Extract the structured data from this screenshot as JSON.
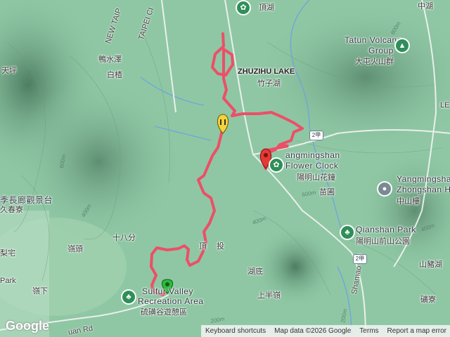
{
  "map": {
    "route_color": "#ec4f68",
    "terrain_color": "#8fc7a4",
    "labels": {
      "ding_hu": "頂湖",
      "zhong_hu": "中湖",
      "tatun_en": "Tatun Volcano",
      "tatun_group": "Group",
      "tatun_zh": "大屯火山群",
      "zhuzihu_en": "ZHUZIHU LAKE",
      "zhuzihu_zh": "竹子湖",
      "new_taipei": "NEW TAIP",
      "taipei_ci": "TAIPEI CI",
      "ya_shui_ze": "鴨水澤",
      "bai_qi": "白楂",
      "tian_ping": "天坪",
      "flower_en1": "angmingshan",
      "flower_en2": "Flower Clock",
      "flower_zh": "陽明山花鐘",
      "miao_pu": "苗圃",
      "ymsh_en1": "Yangmingshan",
      "ymsh_en2": "Zhongshan H",
      "ymsh_zh": "中山樓",
      "qianshan_en": "Qianshan Park",
      "qianshan_zh": "陽明山前山公園",
      "shi_ba_fen": "十八分",
      "ling_tou": "嶺頭",
      "ding_tou": "頂",
      "tou": "投",
      "hu_di": "湖底",
      "shang_ban_ling": "上半嶺",
      "liu_shan_hu": "山豬湖",
      "jiu_chun": "久春寮",
      "ji_zhang": "季長廊觀景台",
      "li_zhai": "梨宅",
      "ling_xia": "嶺下",
      "park": "Park",
      "sulfur_en1": "Sulfur Valley",
      "sulfur_en2": "Recreation Area",
      "sulfur_zh": "硫磺谷遊憩區",
      "shamao_rd": "Shamao Rd",
      "zhongyuan_rd": "uan Rd",
      "ping_liao": "礦寮",
      "le": "LE",
      "zhong_hu_rd": "中湖"
    },
    "shields": [
      "2甲",
      "2甲"
    ],
    "contours": [
      "800m",
      "800m",
      "600m",
      "600m",
      "400m",
      "400m",
      "400m",
      "200m",
      "200m"
    ]
  },
  "footer": {
    "logo": "Google",
    "keyboard": "Keyboard shortcuts",
    "mapdata": "Map data ©2026 Google",
    "terms": "Terms",
    "report": "Report a map error"
  }
}
